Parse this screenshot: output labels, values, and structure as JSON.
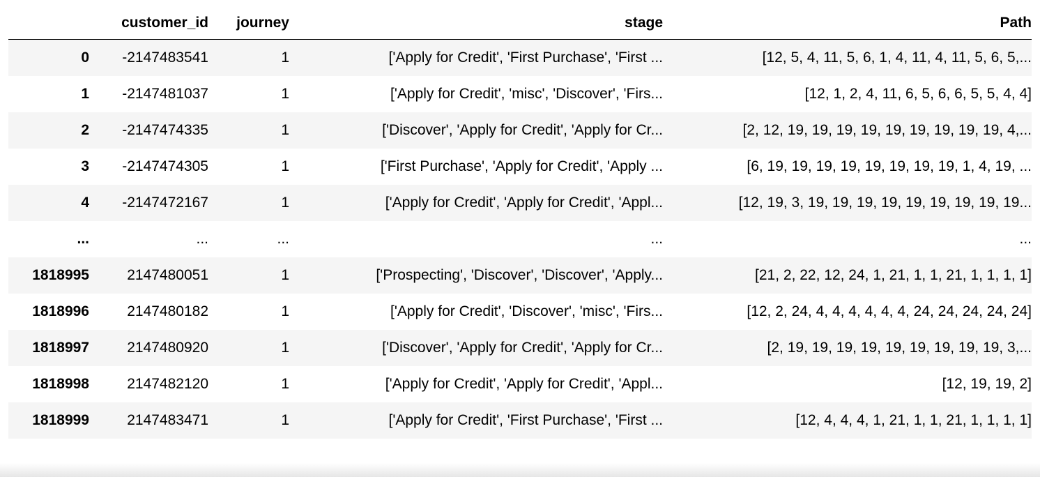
{
  "table": {
    "columns": [
      "",
      "customer_id",
      "journey",
      "stage",
      "Path"
    ],
    "rows": [
      {
        "index": "0",
        "customer_id": "-2147483541",
        "journey": "1",
        "stage": "['Apply for Credit', 'First Purchase', 'First ...",
        "path": "[12, 5, 4, 11, 5, 6, 1, 4, 11, 4, 11, 5, 6, 5,..."
      },
      {
        "index": "1",
        "customer_id": "-2147481037",
        "journey": "1",
        "stage": "['Apply for Credit', 'misc', 'Discover', 'Firs...",
        "path": "[12, 1, 2, 4, 11, 6, 5, 6, 6, 5, 5, 4, 4]"
      },
      {
        "index": "2",
        "customer_id": "-2147474335",
        "journey": "1",
        "stage": "['Discover', 'Apply for Credit', 'Apply for Cr...",
        "path": "[2, 12, 19, 19, 19, 19, 19, 19, 19, 19, 19, 4,..."
      },
      {
        "index": "3",
        "customer_id": "-2147474305",
        "journey": "1",
        "stage": "['First Purchase', 'Apply for Credit', 'Apply ...",
        "path": "[6, 19, 19, 19, 19, 19, 19, 19, 19, 1, 4, 19, ..."
      },
      {
        "index": "4",
        "customer_id": "-2147472167",
        "journey": "1",
        "stage": "['Apply for Credit', 'Apply for Credit', 'Appl...",
        "path": "[12, 19, 3, 19, 19, 19, 19, 19, 19, 19, 19, 19..."
      },
      {
        "index": "...",
        "customer_id": "...",
        "journey": "...",
        "stage": "...",
        "path": "..."
      },
      {
        "index": "1818995",
        "customer_id": "2147480051",
        "journey": "1",
        "stage": "['Prospecting', 'Discover', 'Discover', 'Apply...",
        "path": "[21, 2, 22, 12, 24, 1, 21, 1, 1, 21, 1, 1, 1, 1]"
      },
      {
        "index": "1818996",
        "customer_id": "2147480182",
        "journey": "1",
        "stage": "['Apply for Credit', 'Discover', 'misc', 'Firs...",
        "path": "[12, 2, 24, 4, 4, 4, 4, 4, 4, 24, 24, 24, 24, 24]"
      },
      {
        "index": "1818997",
        "customer_id": "2147480920",
        "journey": "1",
        "stage": "['Discover', 'Apply for Credit', 'Apply for Cr...",
        "path": "[2, 19, 19, 19, 19, 19, 19, 19, 19, 19, 3,..."
      },
      {
        "index": "1818998",
        "customer_id": "2147482120",
        "journey": "1",
        "stage": "['Apply for Credit', 'Apply for Credit', 'Appl...",
        "path": "[12, 19, 19, 2]"
      },
      {
        "index": "1818999",
        "customer_id": "2147483471",
        "journey": "1",
        "stage": "['Apply for Credit', 'First Purchase', 'First ...",
        "path": "[12, 4, 4, 4, 1, 21, 1, 1, 21, 1, 1, 1, 1]"
      }
    ]
  },
  "colors": {
    "stripe": "#f5f5f5",
    "header_rule": "#000000",
    "text": "#000000"
  }
}
